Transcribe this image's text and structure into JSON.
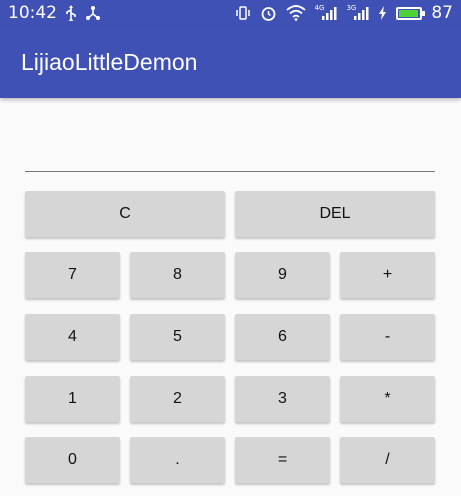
{
  "status_bar": {
    "time": "10:42",
    "network_label_1": "4G",
    "network_label_2": "3G",
    "battery_level": "87",
    "battery_fraction": 0.87,
    "icons": [
      "usb-icon",
      "share-icon",
      "vibrate-icon",
      "alarm-icon",
      "wifi-icon",
      "signal-icon",
      "signal-icon",
      "charging-icon",
      "battery-icon"
    ]
  },
  "app_bar": {
    "title": "LijiaoLittleDemon"
  },
  "display": {
    "value": ""
  },
  "colors": {
    "primary": "#3f51b5",
    "button_bg": "#d6d6d6",
    "background": "#fafafa",
    "battery_fill": "#4cd137"
  },
  "buttons": {
    "clear": "C",
    "delete": "DEL",
    "seven": "7",
    "eight": "8",
    "nine": "9",
    "plus": "+",
    "four": "4",
    "five": "5",
    "six": "6",
    "minus": "-",
    "one": "1",
    "two": "2",
    "three": "3",
    "multiply": "*",
    "zero": "0",
    "dot": ".",
    "equals": "=",
    "divide": "/"
  }
}
